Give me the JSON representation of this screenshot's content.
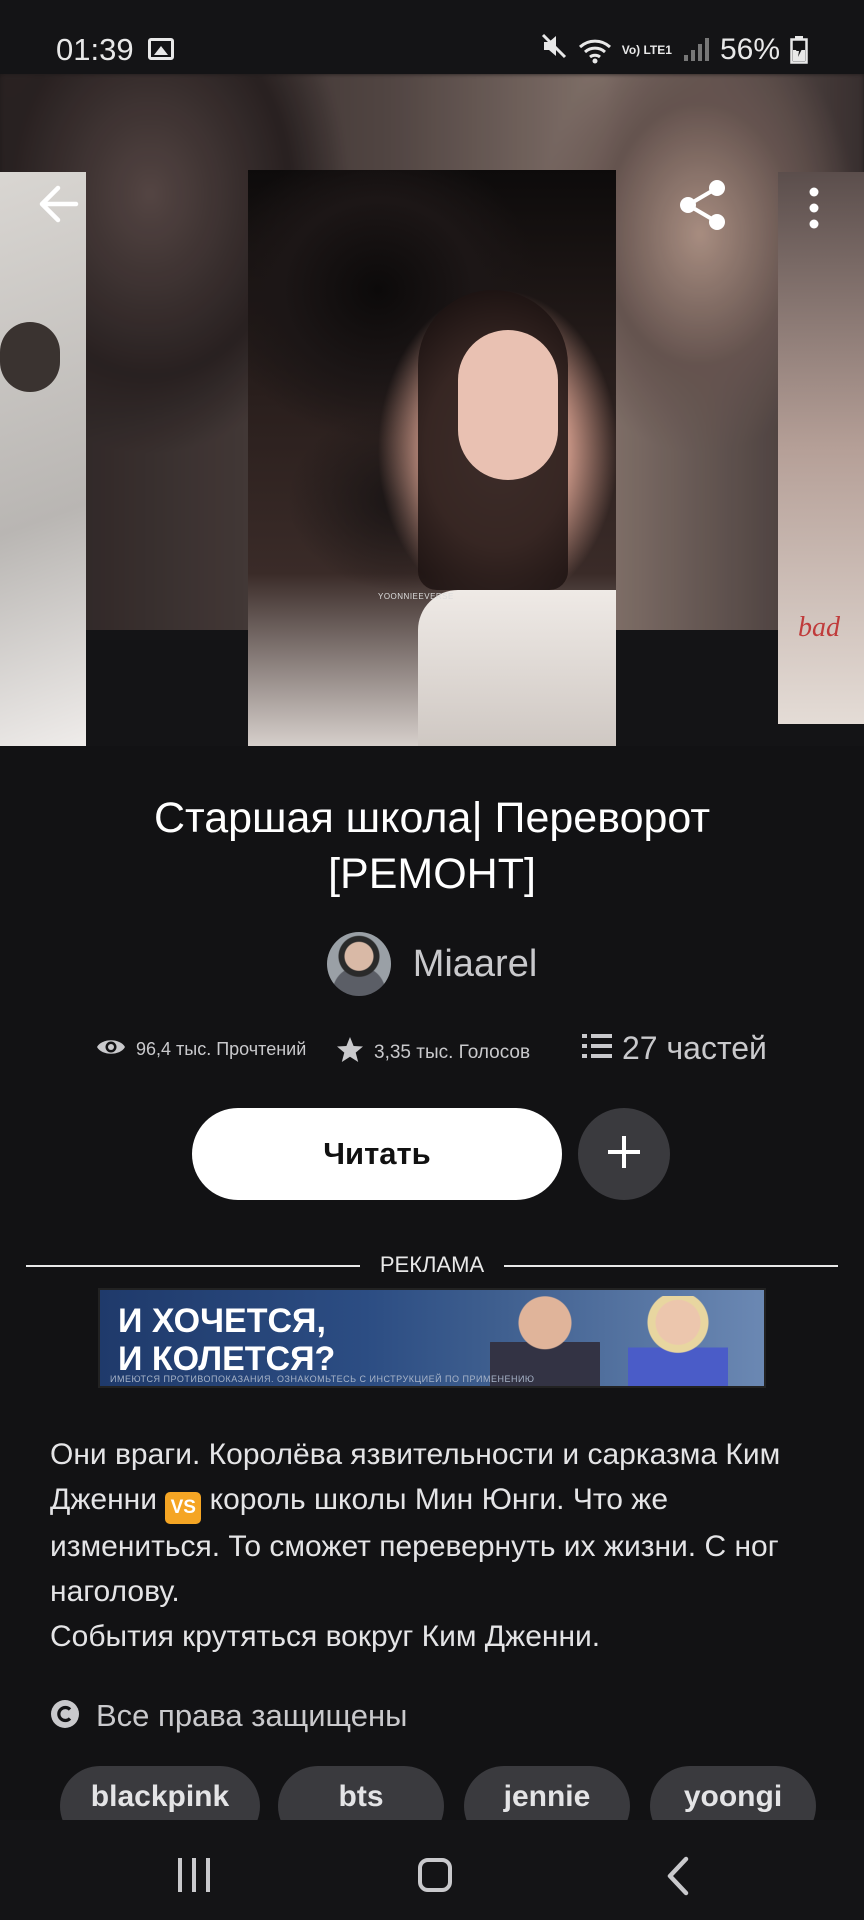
{
  "status_bar": {
    "time": "01:39",
    "network": "Vo) LTE1",
    "battery": "56%",
    "icons": [
      "image-icon",
      "mute-icon",
      "wifi-icon",
      "signal-icon",
      "battery-icon"
    ]
  },
  "header": {
    "icons": [
      "back-arrow-icon",
      "share-icon",
      "more-vertical-icon"
    ]
  },
  "cover": {
    "watermark": "YOONNIEEVERSE",
    "side_text": "bad"
  },
  "story": {
    "title": "Старшая школа| Переворот [РЕМОНТ]",
    "author": "Miaarel",
    "reads": "96,4 тыс. Прочтений",
    "votes": "3,35 тыс. Голосов",
    "parts": "27 частей",
    "read_button": "Читать",
    "description_1a": "Они враги. Королёва язвительности и сарказма Ким Дженни ",
    "vs": "VS",
    "description_1b": " король школы Мин Юнги. Что же измениться. То сможет перевернуть их жизни. С ног наголову.",
    "description_2": "События крутяться вокруг Ким Дженни.",
    "copyright": "Все права защищены",
    "tags": [
      "blackpink",
      "bts",
      "jennie",
      "yoongi"
    ]
  },
  "ad": {
    "label": "РЕКЛАМА",
    "headline_1": "И ХОЧЕТСЯ,",
    "headline_2": "И КОЛЕТСЯ?",
    "fine_print": "ИМЕЮТСЯ ПРОТИВОПОКАЗАНИЯ. ОЗНАКОМЬТЕСЬ С ИНСТРУКЦИЕЙ ПО ПРИМЕНЕНИЮ"
  },
  "colors": {
    "background": "#121214",
    "button_primary": "#ffffff",
    "button_secondary": "#3a3a3e",
    "text_muted": "#c9c9cc"
  }
}
